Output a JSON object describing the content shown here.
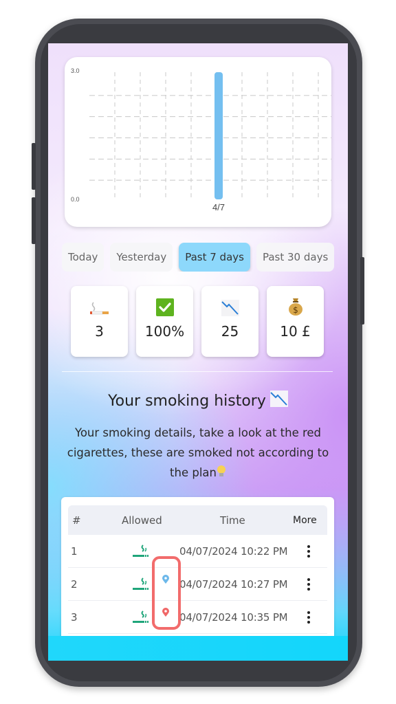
{
  "chart_data": {
    "type": "bar",
    "title": "",
    "xlabel": "",
    "ylabel": "",
    "ylim": [
      0,
      3
    ],
    "y_tick_labels": [
      "3.0",
      "0.0"
    ],
    "grid": true,
    "categories": [
      "4/7"
    ],
    "values": [
      3
    ],
    "bar_color": "#74bff0"
  },
  "tabs": [
    {
      "label": "Today",
      "active": false
    },
    {
      "label": "Yesterday",
      "active": false
    },
    {
      "label": "Past 7 days",
      "active": true
    },
    {
      "label": "Past 30 days",
      "active": false
    }
  ],
  "stats": [
    {
      "icon": "cigarette-icon",
      "value": "3"
    },
    {
      "icon": "check-mark-icon",
      "value": "100%"
    },
    {
      "icon": "chart-decreasing-icon",
      "value": "25"
    },
    {
      "icon": "money-bag-icon",
      "value": "10 £"
    }
  ],
  "history": {
    "title": "Your smoking history",
    "title_icon": "chart-decreasing-icon",
    "description": "Your smoking details, take a look at the red cigarettes, these are smoked not according to the plan",
    "description_icon": "light-bulb-icon"
  },
  "table": {
    "headers": {
      "num": "#",
      "allowed": "Allowed",
      "time": "Time",
      "more": "More"
    },
    "rows": [
      {
        "num": "1",
        "allowed": true,
        "time": "04/07/2024 10:22 PM"
      },
      {
        "num": "2",
        "allowed": true,
        "time": "04/07/2024 10:27 PM"
      },
      {
        "num": "3",
        "allowed": true,
        "time": "04/07/2024 10:35 PM"
      }
    ]
  },
  "annotations": {
    "pins": [
      {
        "icon": "location-pin-icon",
        "color": "#6cb8ea"
      },
      {
        "icon": "location-pin-icon",
        "color": "#f06767"
      }
    ],
    "highlight_color": "#f26c6c"
  },
  "colors": {
    "active_tab": "#8dd8fb",
    "allowed_icon": "#1fa57a",
    "phone_frame": "#4b4c52"
  }
}
